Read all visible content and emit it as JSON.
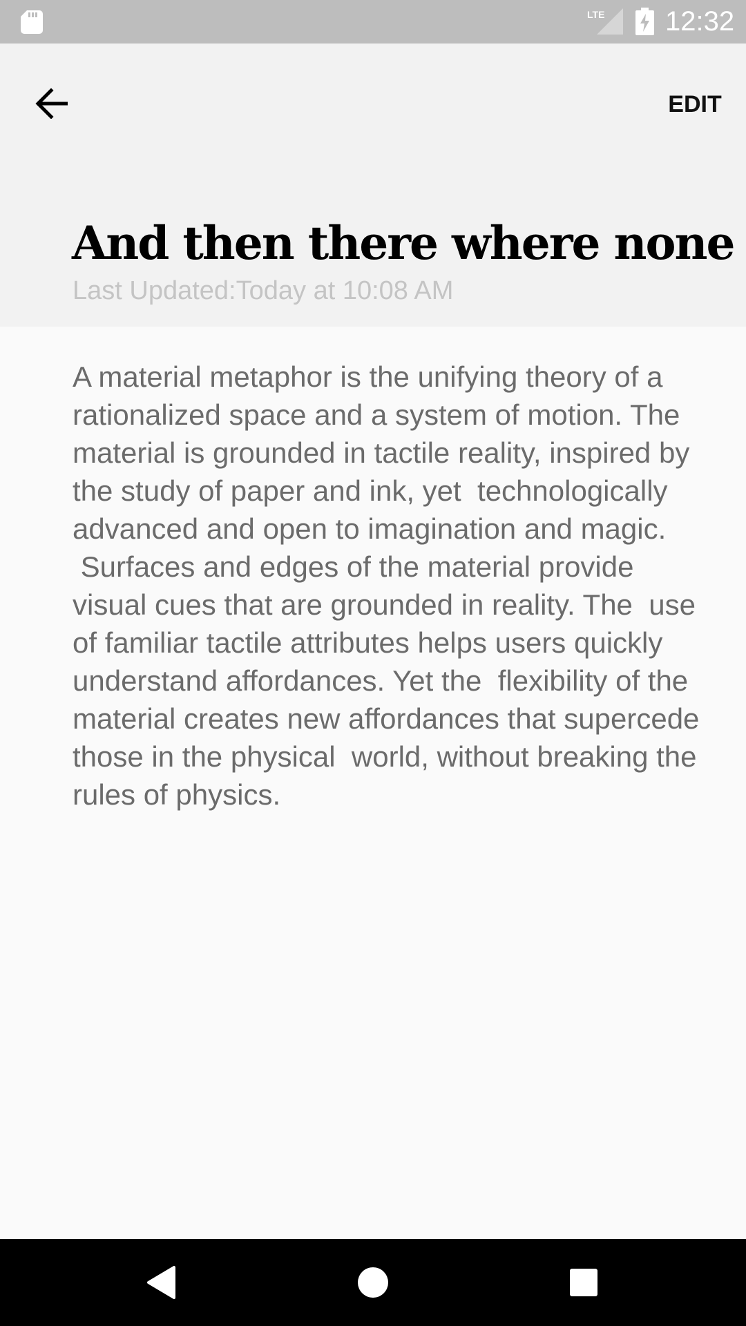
{
  "status_bar": {
    "time": "12:32",
    "network_label": "LTE",
    "icons": [
      "sd-card-icon",
      "lte-signal-icon",
      "battery-charging-icon"
    ]
  },
  "toolbar": {
    "back_icon": "arrow-back-icon",
    "edit_label": "EDIT"
  },
  "note": {
    "title": "And then there where none",
    "last_updated": "Last Updated:Today at 10:08 AM",
    "body": "A material metaphor is the unifying theory of a rationalized space and a system of motion. The material is grounded in tactile reality, inspired by the study of paper and ink, yet  technologically advanced and open to imagination and magic.\n Surfaces and edges of the material provide visual cues that are grounded in reality. The  use of familiar tactile attributes helps users quickly understand affordances. Yet the  flexibility of the material creates new affordances that supercede those in the physical  world, without breaking the rules of physics."
  },
  "nav_bar": {
    "icons": [
      "nav-back-icon",
      "nav-home-icon",
      "nav-recents-icon"
    ]
  },
  "colors": {
    "status_bar": "#bdbdbd",
    "header_bg": "#f2f2f2",
    "page_bg": "#fafafa",
    "title": "#000000",
    "subtitle": "#c4c4c4",
    "body_text": "#6b6b6b",
    "nav_bar": "#000000"
  }
}
